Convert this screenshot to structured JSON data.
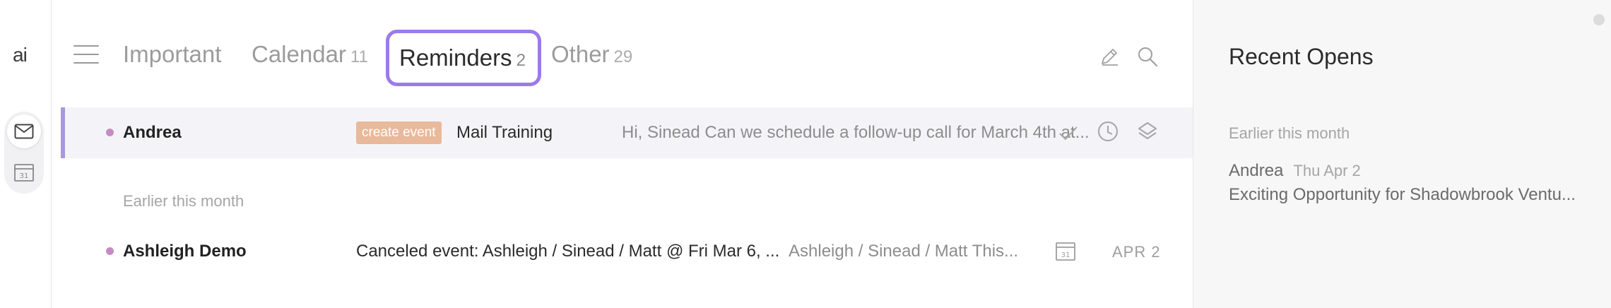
{
  "app": {
    "logo": "ai"
  },
  "tabs": [
    {
      "label": "Important",
      "count": ""
    },
    {
      "label": "Calendar",
      "count": "11"
    },
    {
      "label": "Reminders",
      "count": "2",
      "active": true
    },
    {
      "label": "Other",
      "count": "29"
    }
  ],
  "icons": {
    "menu": "menu-icon",
    "edit": "pencil-icon",
    "search": "search-icon",
    "mail": "mail-icon",
    "calendar": "calendar-icon",
    "done": "check-icon",
    "snooze": "clock-icon",
    "archive": "layers-icon"
  },
  "colors": {
    "accent": "#9b7bea",
    "badge": "#e9b99b",
    "dot": "#c78bc4",
    "selected_bar": "#a79ad8"
  },
  "rail": {
    "calendar_day": "31"
  },
  "rows": [
    {
      "sender": "Andrea",
      "badge": "create event",
      "subject": "Mail Training",
      "snippet": "Hi, Sinead Can we schedule a follow-up call for March 4th at..."
    }
  ],
  "section_earlier": "Earlier this month",
  "rows_earlier": [
    {
      "sender": "Ashleigh Demo",
      "subject": "Canceled event: Ashleigh / Sinead / Matt @ Fri Mar 6, ...",
      "snippet": "Ashleigh / Sinead / Matt This...",
      "calendar_day": "31",
      "date": "APR 2"
    }
  ],
  "sidebar": {
    "title": "Recent Opens",
    "section": "Earlier this month",
    "items": [
      {
        "sender": "Andrea",
        "date": "Thu Apr 2",
        "subject": "Exciting Opportunity for Shadowbrook Ventu..."
      }
    ]
  }
}
